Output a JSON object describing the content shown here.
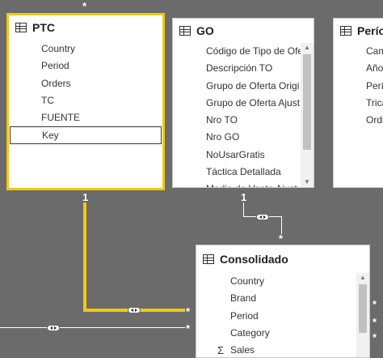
{
  "tables": {
    "ptc": {
      "title": "PTC",
      "fields": [
        "Country",
        "Period",
        "Orders",
        "TC",
        "FUENTE",
        "Key"
      ]
    },
    "go": {
      "title": "GO",
      "fields": [
        "Código de Tipo de Ofe",
        "Descripción TO",
        "Grupo de Oferta Origi",
        "Grupo de Oferta Ajust",
        "Nro TO",
        "Nro GO",
        "NoUsarGratis",
        "Táctica Detallada",
        "Medio de Venta Ajust"
      ]
    },
    "periodo": {
      "title": "Períod",
      "fields": [
        "Cam",
        "Año",
        "Perí",
        "Trica",
        "Ordi"
      ]
    },
    "consolidado": {
      "title": "Consolidado",
      "fields": [
        "Country",
        "Brand",
        "Period",
        "Category",
        "Sales"
      ]
    }
  },
  "cardinality": {
    "ptc_top": "*",
    "ptc_bottom": "1",
    "go_bottom": "1",
    "consolidado_top": "*",
    "consolidado_left_1": "*",
    "consolidado_left_2": "*",
    "right_1": "*",
    "right_2": "*",
    "right_3": "*"
  },
  "colors": {
    "canvas": "#6b6b6b",
    "selected_border": "#f2c811",
    "relationship_line": "#ffffff"
  }
}
